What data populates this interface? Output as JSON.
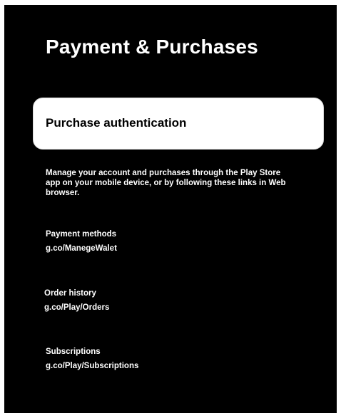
{
  "page": {
    "title": "Payment & Purchases"
  },
  "auth_item": {
    "label": "Purchase authentication"
  },
  "description": "Manage your account and purchases through the Play Store app on your mobile device, or by following these links in Web browser.",
  "sections": [
    {
      "label": "Payment methods",
      "link": "g.co/ManegeWalet"
    },
    {
      "label": "Order history",
      "link": "g.co/Play/Orders"
    },
    {
      "label": "Subscriptions",
      "link": "g.co/Play/Subscriptions"
    }
  ],
  "colors": {
    "panel_background": "#000000",
    "text": "#ffffff",
    "selected_item_background": "#ffffff",
    "selected_item_text": "#000000"
  }
}
